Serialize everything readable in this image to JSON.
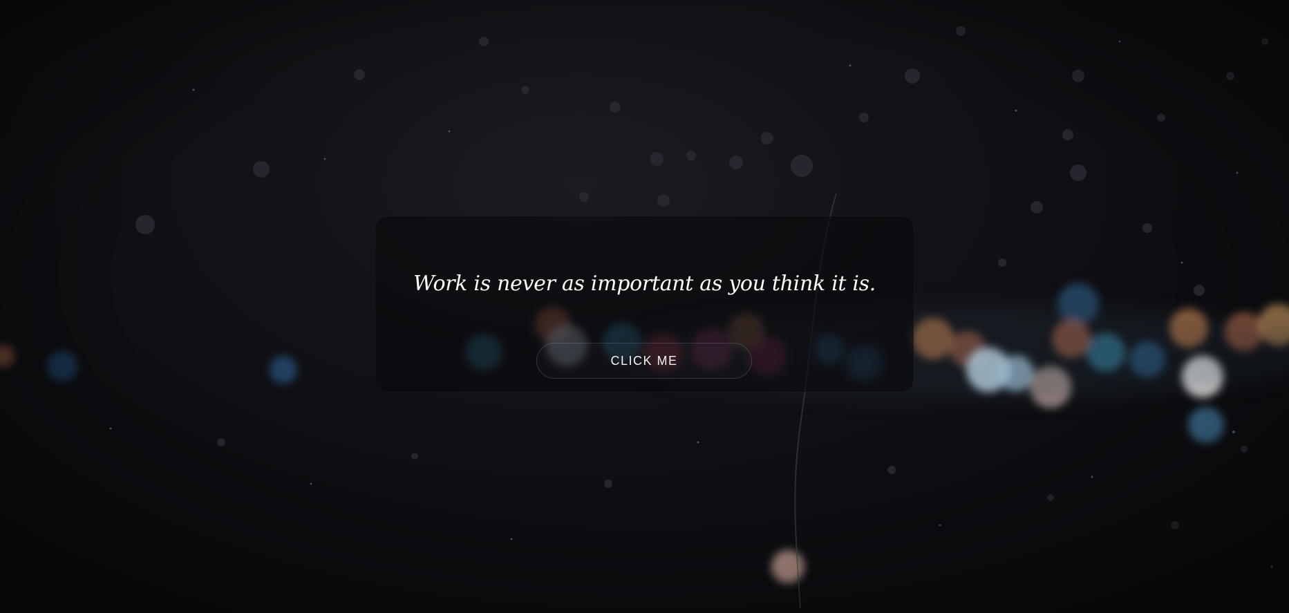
{
  "quote": {
    "text": "Work is never as important as you think it is."
  },
  "cta": {
    "label": "CLICK ME"
  },
  "background": {
    "description_icon": "rain-on-window-bokeh",
    "base_color": "#121216",
    "bokeh_colors": [
      "#e7845a",
      "#3fa2c9",
      "#e33a5f",
      "#ffffff",
      "#f29a55",
      "#2f6fb0"
    ]
  }
}
